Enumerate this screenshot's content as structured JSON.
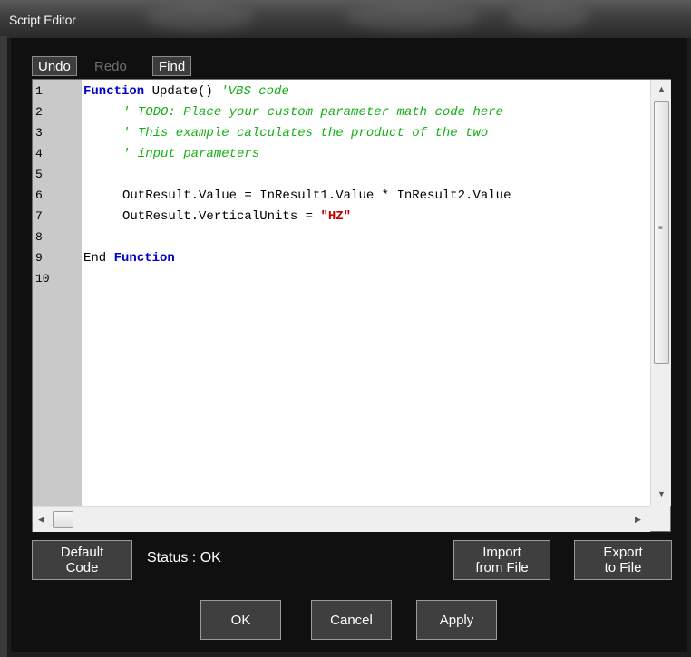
{
  "window": {
    "title": "Script Editor"
  },
  "toolbar": {
    "undo_label": "Undo",
    "redo_label": "Redo",
    "find_label": "Find"
  },
  "editor": {
    "line_numbers": [
      "1",
      "2",
      "3",
      "4",
      "5",
      "6",
      "7",
      "8",
      "9",
      "10"
    ],
    "colors": {
      "keyword": "#0000c8",
      "comment": "#15b015",
      "string": "#c40000",
      "gutter": "#c9c9c9"
    },
    "line1": {
      "kw": "Function",
      "text": " Update() ",
      "comment": "'VBS code"
    },
    "line2": {
      "comment": "' TODO: Place your custom parameter math code here"
    },
    "line3": {
      "comment": "' This example calculates the product of the two"
    },
    "line4": {
      "comment": "' input parameters"
    },
    "line6": {
      "text": "OutResult.Value = InResult1.Value * InResult2.Value"
    },
    "line7": {
      "text": "OutResult.VerticalUnits = ",
      "string": "\"HZ\""
    },
    "line9": {
      "text": "End ",
      "kw": "Function"
    }
  },
  "footer": {
    "default_code_label1": "Default",
    "default_code_label2": "Code",
    "status_text": "Status : OK",
    "import_label1": "Import",
    "import_label2": "from File",
    "export_label1": "Export",
    "export_label2": "to File",
    "ok_label": "OK",
    "cancel_label": "Cancel",
    "apply_label": "Apply"
  }
}
